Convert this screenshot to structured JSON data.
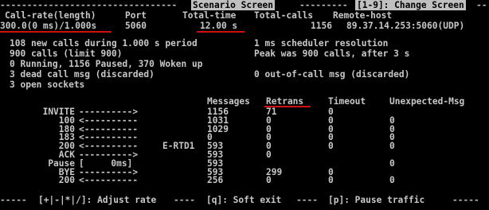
{
  "header": {
    "label": "Scenario Screen",
    "shortcut": "[1-9]: Change Screen"
  },
  "summary": {
    "cols": {
      "call_rate_label": "Call-rate(length)",
      "port_label": "Port",
      "total_time_label": "Total-time",
      "total_calls_label": "Total-calls",
      "remote_host_label": "Remote-host"
    },
    "values": {
      "call_rate": "300.0(0 ms)/1.000s",
      "port": "5060",
      "total_time": "12.00 s",
      "total_calls": "1156",
      "remote_host": "89.37.14.253:5060(UDP)"
    }
  },
  "stats": {
    "new_calls": "108 new calls during 1.000 s period",
    "scheduler": "1 ms scheduler resolution",
    "calls_limit": "900 calls (limit 900)",
    "peak": "Peak was 900 calls, after 3 s",
    "running": "0 Running, 1156 Paused, 370 Woken up",
    "dead_call": "3 dead call msg (discarded)",
    "out_of_call": "0 out-of-call msg (discarded)",
    "open_sockets": "3 open sockets"
  },
  "table": {
    "headers": {
      "messages": "Messages",
      "retrans": "Retrans",
      "timeout": "Timeout",
      "unexpected": "Unexpected-Msg"
    },
    "rows": [
      {
        "label": "INVITE",
        "arrow": "---------->",
        "rtd": "",
        "messages": "1156",
        "retrans": "71",
        "timeout": "0",
        "unexpected": ""
      },
      {
        "label": "100",
        "arrow": "<----------",
        "rtd": "",
        "messages": "1031",
        "retrans": "0",
        "timeout": "0",
        "unexpected": "0"
      },
      {
        "label": "180",
        "arrow": "<----------",
        "rtd": "",
        "messages": "1029",
        "retrans": "0",
        "timeout": "0",
        "unexpected": "0"
      },
      {
        "label": "183",
        "arrow": "<----------",
        "rtd": "",
        "messages": "0",
        "retrans": "0",
        "timeout": "0",
        "unexpected": "0"
      },
      {
        "label": "200",
        "arrow": "<----------",
        "rtd": "E-RTD1",
        "messages": "593",
        "retrans": "0",
        "timeout": "0",
        "unexpected": "0"
      },
      {
        "label": "ACK",
        "arrow": "---------->",
        "rtd": "",
        "messages": "593",
        "retrans": "0",
        "timeout": "",
        "unexpected": ""
      },
      {
        "label": "Pause",
        "arrow": "[     0ms]",
        "rtd": "",
        "messages": "593",
        "retrans": "",
        "timeout": "",
        "unexpected": "0"
      },
      {
        "label": "BYE",
        "arrow": "---------->",
        "rtd": "",
        "messages": "593",
        "retrans": "299",
        "timeout": "0",
        "unexpected": ""
      },
      {
        "label": "200",
        "arrow": "<----------",
        "rtd": "",
        "messages": "256",
        "retrans": "0",
        "timeout": "0",
        "unexpected": "0"
      }
    ]
  },
  "footer": {
    "adjust": "[+|-|*|/]: Adjust rate",
    "soft_exit": "[q]: Soft exit",
    "pause": "[p]: Pause traffic"
  },
  "colors": {
    "background": "#000000",
    "text": "#c8c8c8",
    "header_bg": "#c0c0c0",
    "underline": "#d01010"
  }
}
